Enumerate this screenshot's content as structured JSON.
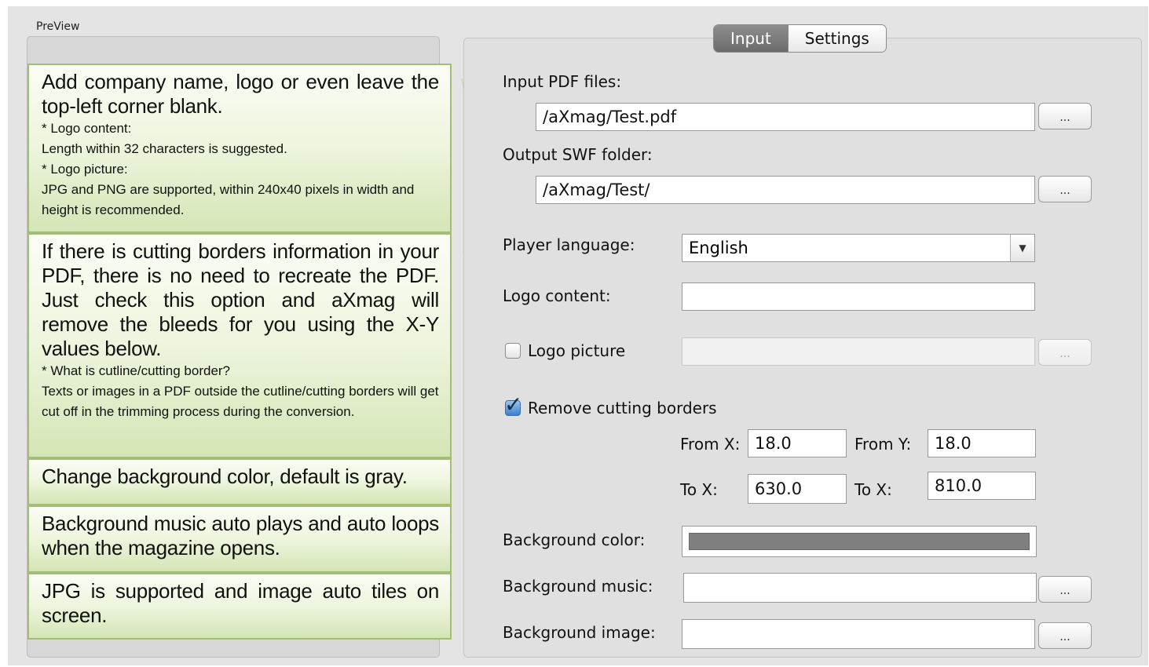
{
  "preview": {
    "label": "PreView"
  },
  "tips": [
    {
      "main": "Add company name, logo or even leave the top-left corner blank.",
      "subs": [
        "* Logo content:",
        "Length within 32 characters is suggested.",
        "* Logo picture:",
        "JPG and PNG are supported, within 240x40 pixels in width and height is recommended."
      ]
    },
    {
      "main": "If there is cutting borders information in your PDF, there is no need to recreate the PDF. Just check this option and aXmag will remove the bleeds for you using the X-Y values below.",
      "subs": [
        "* What is cutline/cutting border?",
        "Texts or images in a PDF outside the cutline/cutting borders will get cut off in the trimming process during the conversion."
      ]
    },
    {
      "main": "Change background color, default is gray.",
      "subs": []
    },
    {
      "main": "Background music auto plays and auto loops when the magazine opens.",
      "subs": []
    },
    {
      "main": "JPG is supported and image auto tiles on screen.",
      "subs": []
    }
  ],
  "tabs": {
    "input": "Input",
    "settings": "Settings"
  },
  "form": {
    "input_pdf_label": "Input PDF files:",
    "input_pdf_value": "/aXmag/Test.pdf",
    "output_swf_label": "Output SWF folder:",
    "output_swf_value": "/aXmag/Test/",
    "player_language_label": "Player language:",
    "player_language_value": "English",
    "logo_content_label": "Logo content:",
    "logo_content_value": "",
    "logo_picture_label": "Logo picture",
    "logo_picture_checked": false,
    "remove_borders_label": "Remove cutting borders",
    "remove_borders_checked": true,
    "from_x_label": "From X:",
    "from_x_value": "18.0",
    "from_y_label": "From Y:",
    "from_y_value": "18.0",
    "to_x_label": "To X:",
    "to_x_value": "630.0",
    "to_y_label": "To X:",
    "to_y_value": "810.0",
    "bg_color_label": "Background color:",
    "bg_color_value": "#7f7f7f",
    "bg_music_label": "Background music:",
    "bg_music_value": "",
    "bg_image_label": "Background image:",
    "bg_image_value": "",
    "browse_label": "...",
    "dropdown_icon": "triangle-down"
  }
}
